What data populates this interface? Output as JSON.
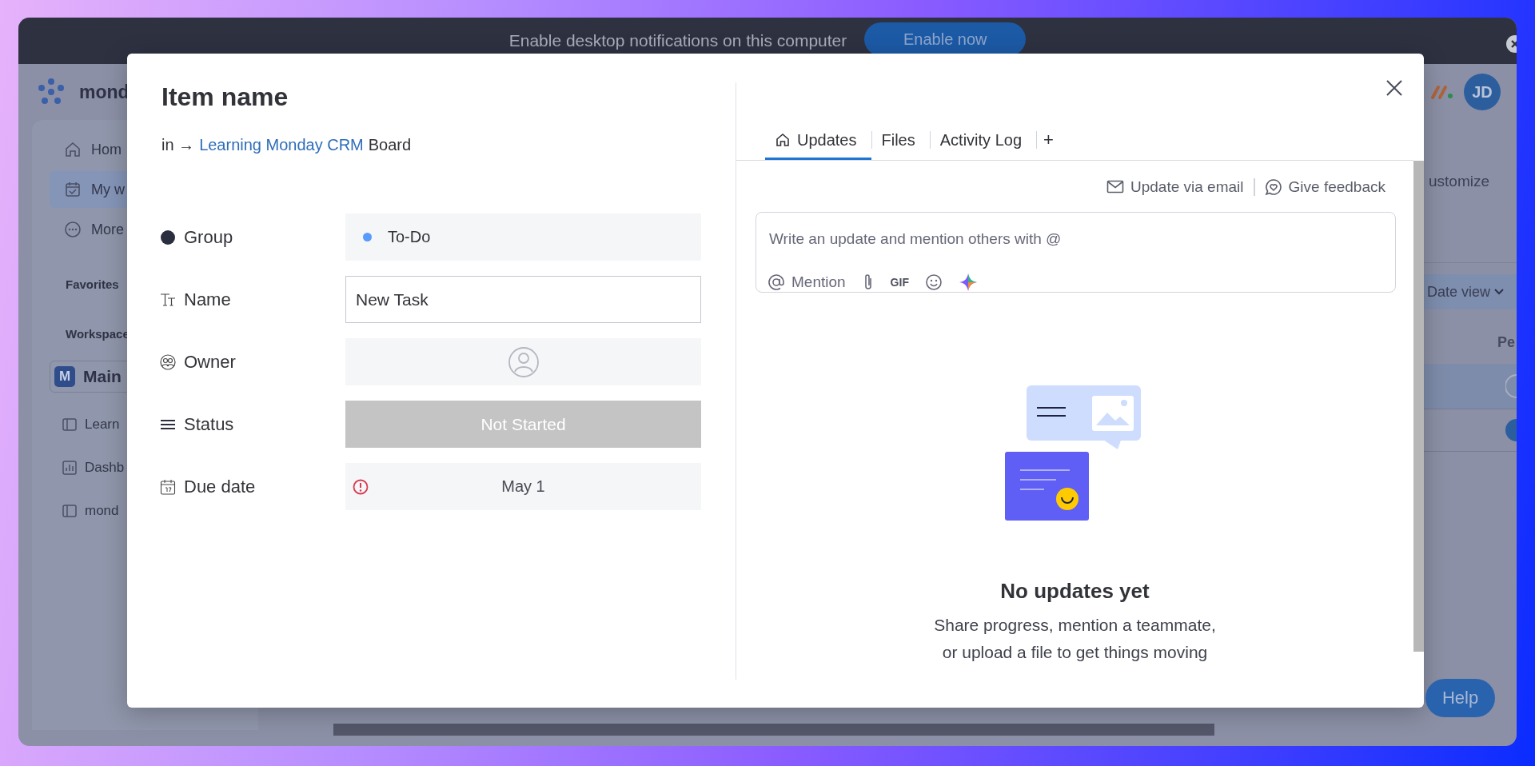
{
  "banner": {
    "text": "Enable desktop notifications on this computer",
    "button": "Enable now"
  },
  "app": {
    "logo_text": "mond",
    "avatar": "JD",
    "sidebar": {
      "nav": [
        {
          "label": "Hom",
          "selected": false
        },
        {
          "label": "My w",
          "selected": true
        },
        {
          "label": "More",
          "selected": false
        }
      ],
      "favorites_heading": "Favorites",
      "workspace_heading": "Workspace",
      "workspace": {
        "initial": "M",
        "name": "Main"
      },
      "boards": [
        {
          "label": "Learn"
        },
        {
          "label": "Dashb"
        },
        {
          "label": "mond"
        }
      ]
    },
    "main": {
      "customize": "ustomize",
      "view_button": "Date view",
      "column_1": "Pe"
    },
    "help": "Help"
  },
  "modal": {
    "title": "Item name",
    "breadcrumb": {
      "prefix": "in →",
      "link": "Learning Monday CRM",
      "suffix": "Board"
    },
    "fields": [
      {
        "kind": "group",
        "label": "Group",
        "value": "To-Do",
        "color": "#579bfc"
      },
      {
        "kind": "text",
        "label": "Name",
        "value": "New Task"
      },
      {
        "kind": "people",
        "label": "Owner"
      },
      {
        "kind": "status",
        "label": "Status",
        "value": "Not Started",
        "color": "#c4c4c4"
      },
      {
        "kind": "date",
        "label": "Due date",
        "value": "May 1",
        "overdue": true
      }
    ],
    "tabs": [
      {
        "label": "Updates",
        "selected": true
      },
      {
        "label": "Files",
        "selected": false
      },
      {
        "label": "Activity Log",
        "selected": false
      }
    ],
    "add_tab": "+",
    "links": [
      "Update via email",
      "Give feedback"
    ],
    "editor": {
      "placeholder": "Write an update and mention others with @",
      "mention": "Mention",
      "gif": "GIF"
    },
    "empty_state": {
      "title": "No updates yet",
      "text": "Share progress, mention a teammate,\nor upload a file to get things moving"
    }
  }
}
